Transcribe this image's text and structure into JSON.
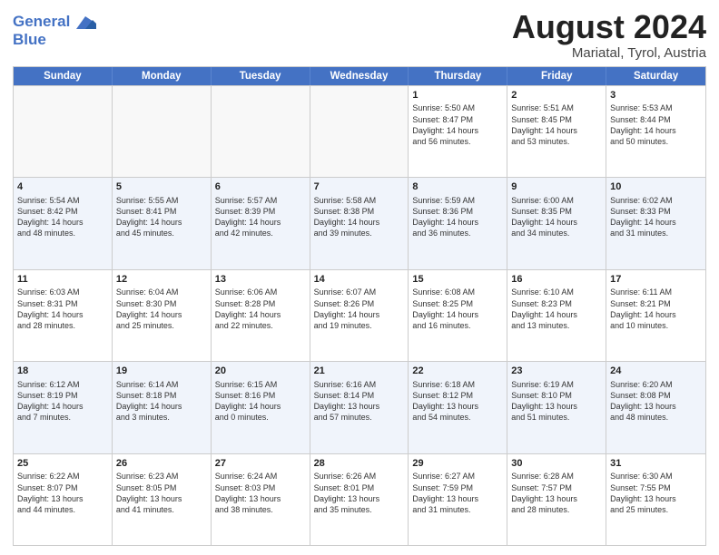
{
  "header": {
    "logo_line1": "General",
    "logo_line2": "Blue",
    "month_year": "August 2024",
    "location": "Mariatal, Tyrol, Austria"
  },
  "days_of_week": [
    "Sunday",
    "Monday",
    "Tuesday",
    "Wednesday",
    "Thursday",
    "Friday",
    "Saturday"
  ],
  "weeks": [
    [
      {
        "day": "",
        "empty": true
      },
      {
        "day": "",
        "empty": true
      },
      {
        "day": "",
        "empty": true
      },
      {
        "day": "",
        "empty": true
      },
      {
        "day": "1",
        "sunrise": "Sunrise: 5:50 AM",
        "sunset": "Sunset: 8:47 PM",
        "daylight": "Daylight: 14 hours and 56 minutes."
      },
      {
        "day": "2",
        "sunrise": "Sunrise: 5:51 AM",
        "sunset": "Sunset: 8:45 PM",
        "daylight": "Daylight: 14 hours and 53 minutes."
      },
      {
        "day": "3",
        "sunrise": "Sunrise: 5:53 AM",
        "sunset": "Sunset: 8:44 PM",
        "daylight": "Daylight: 14 hours and 50 minutes."
      }
    ],
    [
      {
        "day": "4",
        "sunrise": "Sunrise: 5:54 AM",
        "sunset": "Sunset: 8:42 PM",
        "daylight": "Daylight: 14 hours and 48 minutes."
      },
      {
        "day": "5",
        "sunrise": "Sunrise: 5:55 AM",
        "sunset": "Sunset: 8:41 PM",
        "daylight": "Daylight: 14 hours and 45 minutes."
      },
      {
        "day": "6",
        "sunrise": "Sunrise: 5:57 AM",
        "sunset": "Sunset: 8:39 PM",
        "daylight": "Daylight: 14 hours and 42 minutes."
      },
      {
        "day": "7",
        "sunrise": "Sunrise: 5:58 AM",
        "sunset": "Sunset: 8:38 PM",
        "daylight": "Daylight: 14 hours and 39 minutes."
      },
      {
        "day": "8",
        "sunrise": "Sunrise: 5:59 AM",
        "sunset": "Sunset: 8:36 PM",
        "daylight": "Daylight: 14 hours and 36 minutes."
      },
      {
        "day": "9",
        "sunrise": "Sunrise: 6:00 AM",
        "sunset": "Sunset: 8:35 PM",
        "daylight": "Daylight: 14 hours and 34 minutes."
      },
      {
        "day": "10",
        "sunrise": "Sunrise: 6:02 AM",
        "sunset": "Sunset: 8:33 PM",
        "daylight": "Daylight: 14 hours and 31 minutes."
      }
    ],
    [
      {
        "day": "11",
        "sunrise": "Sunrise: 6:03 AM",
        "sunset": "Sunset: 8:31 PM",
        "daylight": "Daylight: 14 hours and 28 minutes."
      },
      {
        "day": "12",
        "sunrise": "Sunrise: 6:04 AM",
        "sunset": "Sunset: 8:30 PM",
        "daylight": "Daylight: 14 hours and 25 minutes."
      },
      {
        "day": "13",
        "sunrise": "Sunrise: 6:06 AM",
        "sunset": "Sunset: 8:28 PM",
        "daylight": "Daylight: 14 hours and 22 minutes."
      },
      {
        "day": "14",
        "sunrise": "Sunrise: 6:07 AM",
        "sunset": "Sunset: 8:26 PM",
        "daylight": "Daylight: 14 hours and 19 minutes."
      },
      {
        "day": "15",
        "sunrise": "Sunrise: 6:08 AM",
        "sunset": "Sunset: 8:25 PM",
        "daylight": "Daylight: 14 hours and 16 minutes."
      },
      {
        "day": "16",
        "sunrise": "Sunrise: 6:10 AM",
        "sunset": "Sunset: 8:23 PM",
        "daylight": "Daylight: 14 hours and 13 minutes."
      },
      {
        "day": "17",
        "sunrise": "Sunrise: 6:11 AM",
        "sunset": "Sunset: 8:21 PM",
        "daylight": "Daylight: 14 hours and 10 minutes."
      }
    ],
    [
      {
        "day": "18",
        "sunrise": "Sunrise: 6:12 AM",
        "sunset": "Sunset: 8:19 PM",
        "daylight": "Daylight: 14 hours and 7 minutes."
      },
      {
        "day": "19",
        "sunrise": "Sunrise: 6:14 AM",
        "sunset": "Sunset: 8:18 PM",
        "daylight": "Daylight: 14 hours and 3 minutes."
      },
      {
        "day": "20",
        "sunrise": "Sunrise: 6:15 AM",
        "sunset": "Sunset: 8:16 PM",
        "daylight": "Daylight: 14 hours and 0 minutes."
      },
      {
        "day": "21",
        "sunrise": "Sunrise: 6:16 AM",
        "sunset": "Sunset: 8:14 PM",
        "daylight": "Daylight: 13 hours and 57 minutes."
      },
      {
        "day": "22",
        "sunrise": "Sunrise: 6:18 AM",
        "sunset": "Sunset: 8:12 PM",
        "daylight": "Daylight: 13 hours and 54 minutes."
      },
      {
        "day": "23",
        "sunrise": "Sunrise: 6:19 AM",
        "sunset": "Sunset: 8:10 PM",
        "daylight": "Daylight: 13 hours and 51 minutes."
      },
      {
        "day": "24",
        "sunrise": "Sunrise: 6:20 AM",
        "sunset": "Sunset: 8:08 PM",
        "daylight": "Daylight: 13 hours and 48 minutes."
      }
    ],
    [
      {
        "day": "25",
        "sunrise": "Sunrise: 6:22 AM",
        "sunset": "Sunset: 8:07 PM",
        "daylight": "Daylight: 13 hours and 44 minutes."
      },
      {
        "day": "26",
        "sunrise": "Sunrise: 6:23 AM",
        "sunset": "Sunset: 8:05 PM",
        "daylight": "Daylight: 13 hours and 41 minutes."
      },
      {
        "day": "27",
        "sunrise": "Sunrise: 6:24 AM",
        "sunset": "Sunset: 8:03 PM",
        "daylight": "Daylight: 13 hours and 38 minutes."
      },
      {
        "day": "28",
        "sunrise": "Sunrise: 6:26 AM",
        "sunset": "Sunset: 8:01 PM",
        "daylight": "Daylight: 13 hours and 35 minutes."
      },
      {
        "day": "29",
        "sunrise": "Sunrise: 6:27 AM",
        "sunset": "Sunset: 7:59 PM",
        "daylight": "Daylight: 13 hours and 31 minutes."
      },
      {
        "day": "30",
        "sunrise": "Sunrise: 6:28 AM",
        "sunset": "Sunset: 7:57 PM",
        "daylight": "Daylight: 13 hours and 28 minutes."
      },
      {
        "day": "31",
        "sunrise": "Sunrise: 6:30 AM",
        "sunset": "Sunset: 7:55 PM",
        "daylight": "Daylight: 13 hours and 25 minutes."
      }
    ]
  ]
}
